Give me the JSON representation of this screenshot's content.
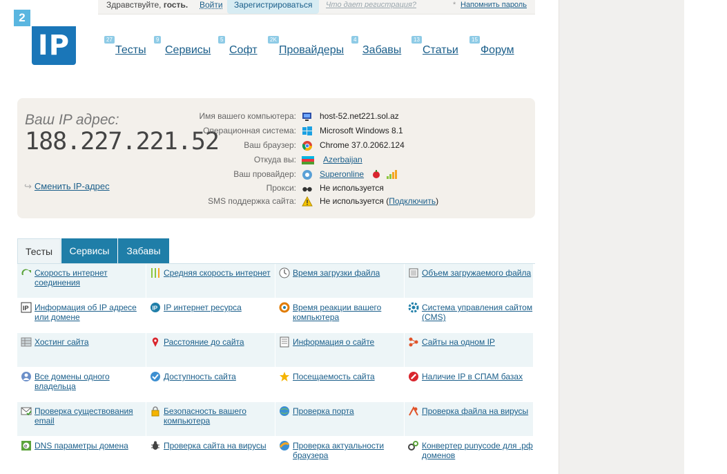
{
  "login_bar": {
    "greeting": "Здравствуйте,",
    "guest": "гость.",
    "login": "Войти",
    "register": "Зарегистрироваться",
    "register_why": "Что дает регистрация?",
    "remind_password": "Напомнить пароль"
  },
  "logo": {
    "badge": "2",
    "text": "IP"
  },
  "nav": [
    {
      "label": "Тесты",
      "count": "27"
    },
    {
      "label": "Сервисы",
      "count": "9"
    },
    {
      "label": "Софт",
      "count": "5"
    },
    {
      "label": "Провайдеры",
      "count": "2K"
    },
    {
      "label": "Забавы",
      "count": "4"
    },
    {
      "label": "Статьи",
      "count": "13"
    },
    {
      "label": "Форум",
      "count": "15"
    }
  ],
  "ip_panel": {
    "caption": "Ваш IP адрес:",
    "ip": "188.227.221.52",
    "change_ip": "Сменить IP-адрес",
    "rows": [
      {
        "label": "Имя вашего компьютера:",
        "value": "host-52.net221.sol.az",
        "icon": "computer-icon"
      },
      {
        "label": "Операционная система:",
        "value": "Microsoft Windows 8.1",
        "icon": "windows-icon"
      },
      {
        "label": "Ваш браузер:",
        "value": "Chrome 37.0.2062.124",
        "icon": "chrome-icon"
      },
      {
        "label": "Откуда вы:",
        "value": "Azerbaijan",
        "icon": "flag-icon",
        "link": true
      },
      {
        "label": "Ваш провайдер:",
        "value": "Superonline",
        "icon": "provider-icon",
        "link": true
      },
      {
        "label": "Прокси:",
        "value": "Не используется",
        "icon": "glasses-icon"
      },
      {
        "label": "SMS поддержка сайта:",
        "value": "Не используется",
        "icon": "warning-icon",
        "extra_open": "(",
        "extra_link": "Подключить",
        "extra_close": ")"
      }
    ]
  },
  "tabs": {
    "tests": "Тесты",
    "services": "Сервисы",
    "fun": "Забавы"
  },
  "tools": [
    {
      "label": "Скорость интернет соединения",
      "icon": "speed-arrow-icon"
    },
    {
      "label": "Средняя скорость интернет",
      "icon": "bars-icon"
    },
    {
      "label": "Время загрузки файла",
      "icon": "clock-icon"
    },
    {
      "label": "Объем загружаемого файла",
      "icon": "file-size-icon"
    },
    {
      "label": "Информация об IP адресе или домене",
      "icon": "ip-icon"
    },
    {
      "label": "IP интернет ресурса",
      "icon": "ip-round-icon"
    },
    {
      "label": "Время реакции вашего компьютера",
      "icon": "refresh-icon"
    },
    {
      "label": "Система управления сайтом (CMS)",
      "icon": "gear-icon"
    },
    {
      "label": "Хостинг сайта",
      "icon": "server-icon"
    },
    {
      "label": "Расстояние до сайта",
      "icon": "map-pin-icon"
    },
    {
      "label": "Информация о сайте",
      "icon": "document-icon"
    },
    {
      "label": "Сайты на одном IP",
      "icon": "network-icon"
    },
    {
      "label": "Все домены одного владельца",
      "icon": "owner-icon"
    },
    {
      "label": "Доступность сайта",
      "icon": "globe-check-icon"
    },
    {
      "label": "Посещаемость сайта",
      "icon": "star-icon"
    },
    {
      "label": "Наличие IP в СПАМ базах",
      "icon": "no-entry-icon"
    },
    {
      "label": "Проверка существования email",
      "icon": "mail-icon"
    },
    {
      "label": "Безопасность вашего компьютера",
      "icon": "lock-icon"
    },
    {
      "label": "Проверка порта",
      "icon": "port-globe-icon"
    },
    {
      "label": "Проверка файла на вирусы",
      "icon": "virus-file-icon"
    },
    {
      "label": "DNS параметры домена",
      "icon": "dns-icon"
    },
    {
      "label": "Проверка сайта на вирусы",
      "icon": "bug-icon"
    },
    {
      "label": "Проверка актуальности браузера",
      "icon": "browser-icon"
    },
    {
      "label": "Конвертер punycode для .рф доменов",
      "icon": "converter-icon"
    }
  ]
}
